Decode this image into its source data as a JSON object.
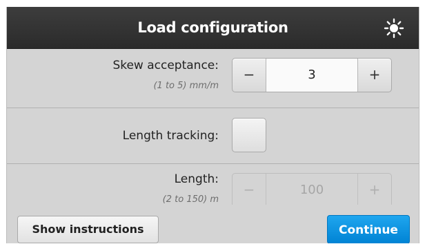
{
  "header": {
    "title": "Load configuration",
    "brightness_icon": "sun-brightness-icon"
  },
  "skew_acceptance": {
    "label": "Skew acceptance:",
    "hint": "(1 to 5) mm/m",
    "value": "3",
    "decrement_label": "−",
    "increment_label": "+",
    "enabled": true
  },
  "length_tracking": {
    "label": "Length tracking:",
    "checked": false
  },
  "length": {
    "label": "Length:",
    "hint": "(2 to 150) m",
    "value": "100",
    "decrement_label": "−",
    "increment_label": "+",
    "enabled": false
  },
  "footer": {
    "show_instructions_label": "Show instructions",
    "continue_label": "Continue"
  },
  "colors": {
    "header_bg": "#2f2f2f",
    "panel_bg": "#d4d4d4",
    "primary_button": "#0a93e0"
  }
}
